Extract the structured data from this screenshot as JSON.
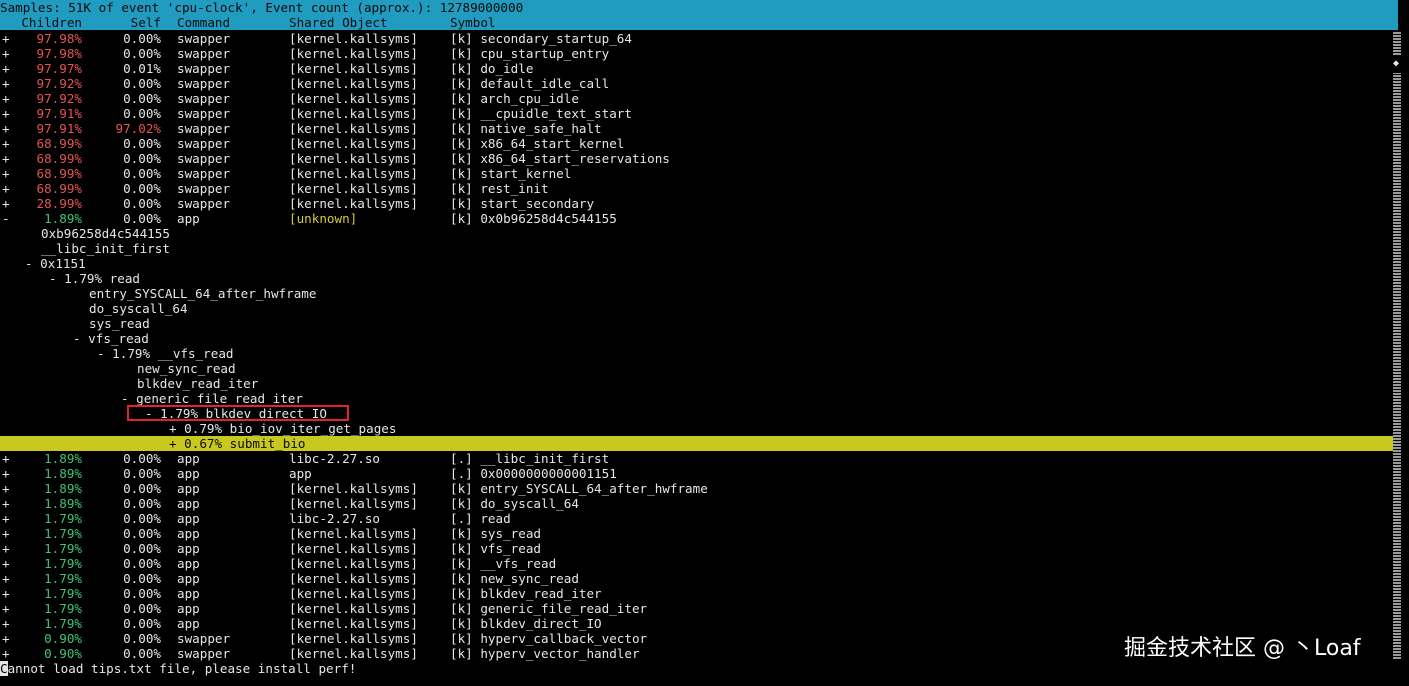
{
  "title": "Samples: 51K of event 'cpu-clock', Event count (approx.): 12789000000",
  "columns": [
    "Children",
    "Self",
    "Command",
    "Shared Object",
    "Symbol"
  ],
  "rows_top": [
    {
      "marker": "+",
      "children": "97.98%",
      "self": "0.00%",
      "command": "swapper",
      "dso": "[kernel.kallsyms]",
      "symbol": "[k] secondary_startup_64"
    },
    {
      "marker": "+",
      "children": "97.98%",
      "self": "0.00%",
      "command": "swapper",
      "dso": "[kernel.kallsyms]",
      "symbol": "[k] cpu_startup_entry"
    },
    {
      "marker": "+",
      "children": "97.97%",
      "self": "0.01%",
      "command": "swapper",
      "dso": "[kernel.kallsyms]",
      "symbol": "[k] do_idle"
    },
    {
      "marker": "+",
      "children": "97.92%",
      "self": "0.00%",
      "command": "swapper",
      "dso": "[kernel.kallsyms]",
      "symbol": "[k] default_idle_call"
    },
    {
      "marker": "+",
      "children": "97.92%",
      "self": "0.00%",
      "command": "swapper",
      "dso": "[kernel.kallsyms]",
      "symbol": "[k] arch_cpu_idle"
    },
    {
      "marker": "+",
      "children": "97.91%",
      "self": "0.00%",
      "command": "swapper",
      "dso": "[kernel.kallsyms]",
      "symbol": "[k] __cpuidle_text_start"
    },
    {
      "marker": "+",
      "children": "97.91%",
      "self": "97.02%",
      "command": "swapper",
      "dso": "[kernel.kallsyms]",
      "symbol": "[k] native_safe_halt"
    },
    {
      "marker": "+",
      "children": "68.99%",
      "self": "0.00%",
      "command": "swapper",
      "dso": "[kernel.kallsyms]",
      "symbol": "[k] x86_64_start_kernel"
    },
    {
      "marker": "+",
      "children": "68.99%",
      "self": "0.00%",
      "command": "swapper",
      "dso": "[kernel.kallsyms]",
      "symbol": "[k] x86_64_start_reservations"
    },
    {
      "marker": "+",
      "children": "68.99%",
      "self": "0.00%",
      "command": "swapper",
      "dso": "[kernel.kallsyms]",
      "symbol": "[k] start_kernel"
    },
    {
      "marker": "+",
      "children": "68.99%",
      "self": "0.00%",
      "command": "swapper",
      "dso": "[kernel.kallsyms]",
      "symbol": "[k] rest_init"
    },
    {
      "marker": "+",
      "children": "28.99%",
      "self": "0.00%",
      "command": "swapper",
      "dso": "[kernel.kallsyms]",
      "symbol": "[k] start_secondary"
    },
    {
      "marker": "-",
      "children": "1.89%",
      "self": "0.00%",
      "command": "app",
      "dso": "[unknown]",
      "symbol": "[k] 0x0b96258d4c544155"
    }
  ],
  "tree": [
    "0xb96258d4c544155",
    "__libc_init_first",
    "- 0x1151",
    "- 1.79% read",
    "entry_SYSCALL_64_after_hwframe",
    "do_syscall_64",
    "sys_read",
    "- vfs_read",
    "- 1.79% __vfs_read",
    "new_sync_read",
    "blkdev_read_iter",
    "- generic_file_read_iter",
    "- 1.79% blkdev_direct_IO",
    "+ 0.79% bio_iov_iter_get_pages",
    "+ 0.67% submit_bio"
  ],
  "rows_bottom": [
    {
      "marker": "+",
      "children": "1.89%",
      "self": "0.00%",
      "command": "app",
      "dso": "libc-2.27.so",
      "symbol": "[.] __libc_init_first"
    },
    {
      "marker": "+",
      "children": "1.89%",
      "self": "0.00%",
      "command": "app",
      "dso": "app",
      "symbol": "[.] 0x0000000000001151"
    },
    {
      "marker": "+",
      "children": "1.89%",
      "self": "0.00%",
      "command": "app",
      "dso": "[kernel.kallsyms]",
      "symbol": "[k] entry_SYSCALL_64_after_hwframe"
    },
    {
      "marker": "+",
      "children": "1.89%",
      "self": "0.00%",
      "command": "app",
      "dso": "[kernel.kallsyms]",
      "symbol": "[k] do_syscall_64"
    },
    {
      "marker": "+",
      "children": "1.79%",
      "self": "0.00%",
      "command": "app",
      "dso": "libc-2.27.so",
      "symbol": "[.] read"
    },
    {
      "marker": "+",
      "children": "1.79%",
      "self": "0.00%",
      "command": "app",
      "dso": "[kernel.kallsyms]",
      "symbol": "[k] sys_read"
    },
    {
      "marker": "+",
      "children": "1.79%",
      "self": "0.00%",
      "command": "app",
      "dso": "[kernel.kallsyms]",
      "symbol": "[k] vfs_read"
    },
    {
      "marker": "+",
      "children": "1.79%",
      "self": "0.00%",
      "command": "app",
      "dso": "[kernel.kallsyms]",
      "symbol": "[k] __vfs_read"
    },
    {
      "marker": "+",
      "children": "1.79%",
      "self": "0.00%",
      "command": "app",
      "dso": "[kernel.kallsyms]",
      "symbol": "[k] new_sync_read"
    },
    {
      "marker": "+",
      "children": "1.79%",
      "self": "0.00%",
      "command": "app",
      "dso": "[kernel.kallsyms]",
      "symbol": "[k] blkdev_read_iter"
    },
    {
      "marker": "+",
      "children": "1.79%",
      "self": "0.00%",
      "command": "app",
      "dso": "[kernel.kallsyms]",
      "symbol": "[k] generic_file_read_iter"
    },
    {
      "marker": "+",
      "children": "1.79%",
      "self": "0.00%",
      "command": "app",
      "dso": "[kernel.kallsyms]",
      "symbol": "[k] blkdev_direct_IO"
    },
    {
      "marker": "+",
      "children": "0.90%",
      "self": "0.00%",
      "command": "swapper",
      "dso": "[kernel.kallsyms]",
      "symbol": "[k] hyperv_callback_vector"
    },
    {
      "marker": "+",
      "children": "0.90%",
      "self": "0.00%",
      "command": "swapper",
      "dso": "[kernel.kallsyms]",
      "symbol": "[k] hyperv_vector_handler"
    }
  ],
  "status": "annot load tips.txt file, please install perf!",
  "status_cursor_char": "C",
  "scroll_indicator": "◆",
  "watermark": "掘金技术社区 @ 丶Loaf",
  "colors": {
    "header_bg": "#1f9cc0",
    "selected_bg": "#c8c81e",
    "high": "#e55353",
    "low": "#3ec27a",
    "unknown": "#d6c83a",
    "box": "#e0242b"
  }
}
